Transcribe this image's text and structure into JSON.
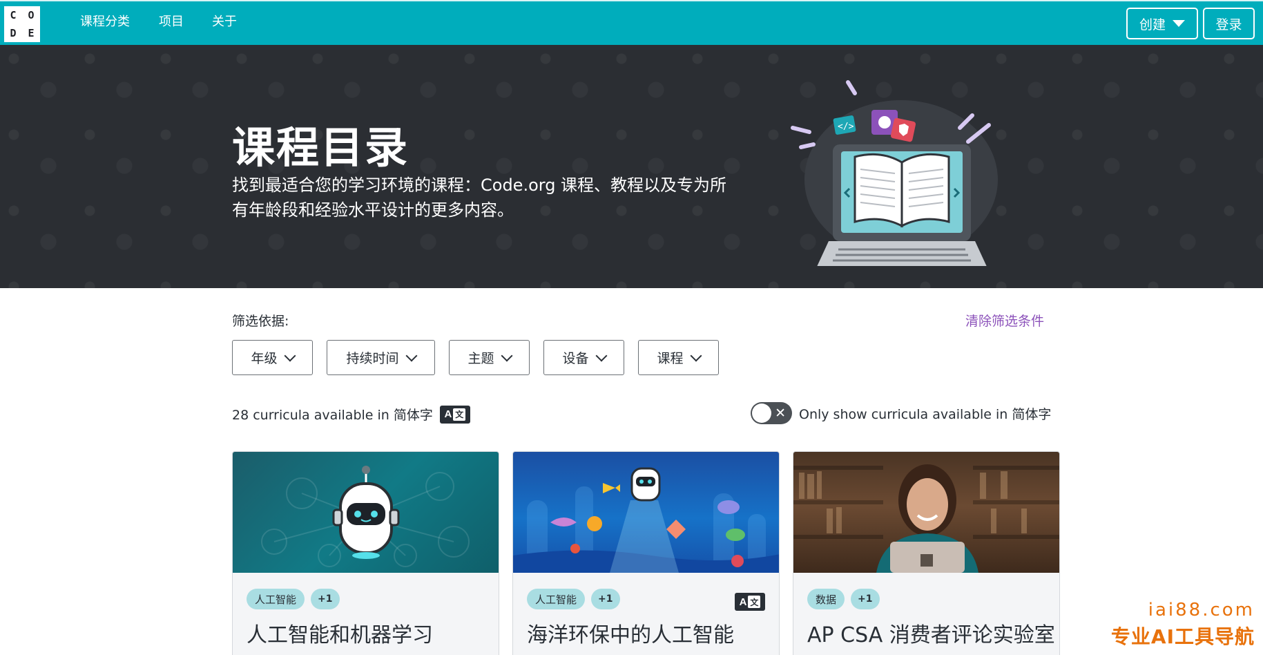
{
  "nav": {
    "logo_letters": [
      "C",
      "O",
      "D",
      "E"
    ],
    "links": [
      "课程分类",
      "项目",
      "关于"
    ],
    "create_label": "创建",
    "login_label": "登录"
  },
  "hero": {
    "title": "课程目录",
    "subtitle": "找到最适合您的学习环境的课程：Code.org 课程、教程以及专为所有年龄段和经验水平设计的更多内容。"
  },
  "filters": {
    "label": "筛选依据:",
    "clear_label": "清除筛选条件",
    "dropdowns": [
      "年级",
      "持续时间",
      "主题",
      "设备",
      "课程"
    ]
  },
  "availability": {
    "count_text": "28 curricula available in 简体字",
    "toggle_label": "Only show curricula available in 简体字",
    "toggle_on": false,
    "lang_badge_a": "A",
    "lang_badge_zh": "文"
  },
  "cards": [
    {
      "tags": [
        "人工智能",
        "+1"
      ],
      "title": "人工智能和机器学习",
      "image": "ai-robot-illustration",
      "lang_badge": false
    },
    {
      "tags": [
        "人工智能",
        "+1"
      ],
      "title": "海洋环保中的人工智能",
      "image": "ocean-robot-illustration",
      "lang_badge": true
    },
    {
      "tags": [
        "数据",
        "+1"
      ],
      "title": "AP CSA 消费者评论实验室",
      "image": "student-library-photo",
      "lang_badge": false
    }
  ],
  "watermark": {
    "line1": "iai88.com",
    "line2": "专业AI工具导航"
  },
  "colors": {
    "nav_bg": "#00adbc",
    "hero_bg": "#2b2e33",
    "link_purple": "#8c52ba",
    "tag_bg": "#a9dde2",
    "watermark": "#e8720c"
  }
}
